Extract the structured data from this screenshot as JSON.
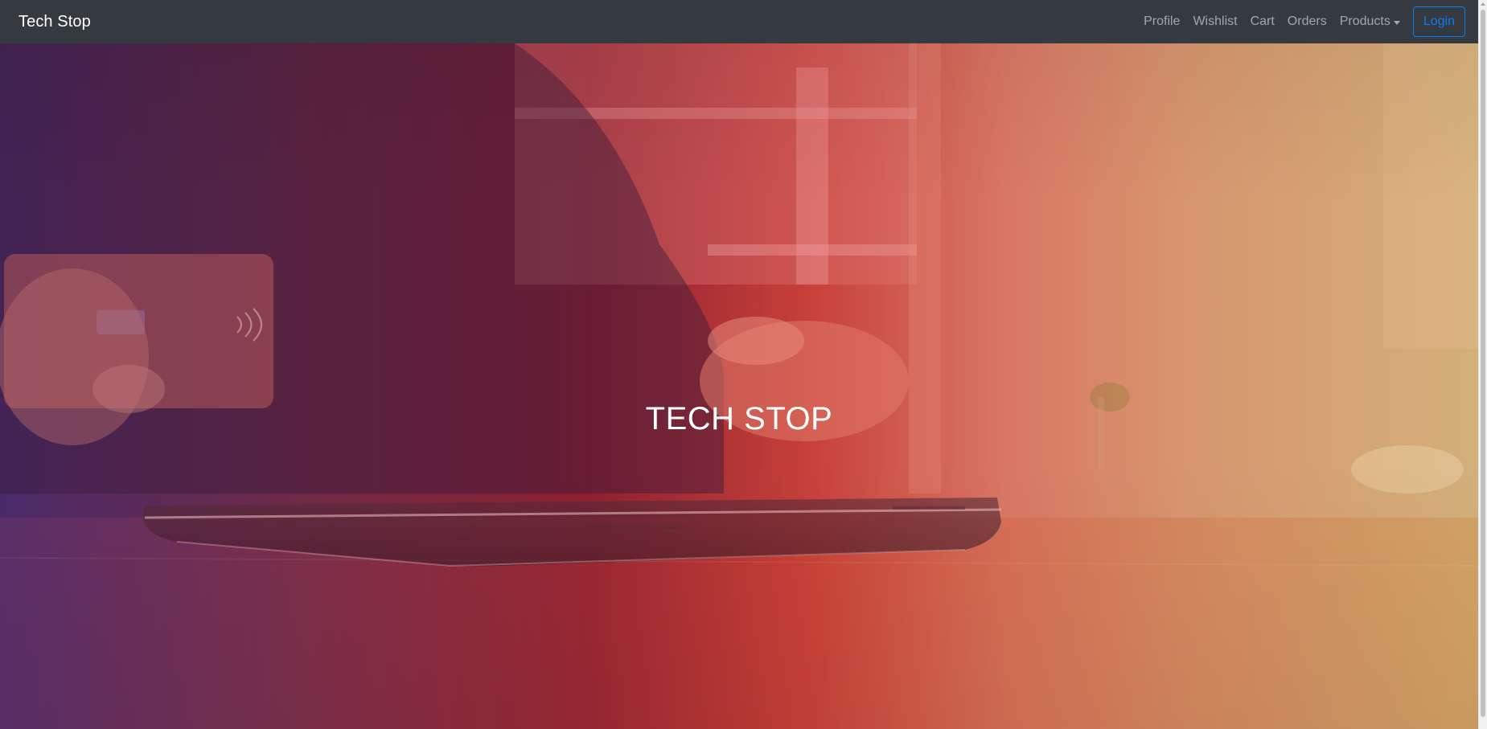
{
  "navbar": {
    "brand": "Tech Stop",
    "links": {
      "profile": "Profile",
      "wishlist": "Wishlist",
      "cart": "Cart",
      "orders": "Orders",
      "products": "Products"
    },
    "login_label": "Login"
  },
  "hero": {
    "title": "TECH STOP"
  },
  "colors": {
    "navbar_bg": "#343a40",
    "login_accent": "#0d7ef0"
  },
  "icons": {
    "products_caret": "chevron-down-icon"
  }
}
